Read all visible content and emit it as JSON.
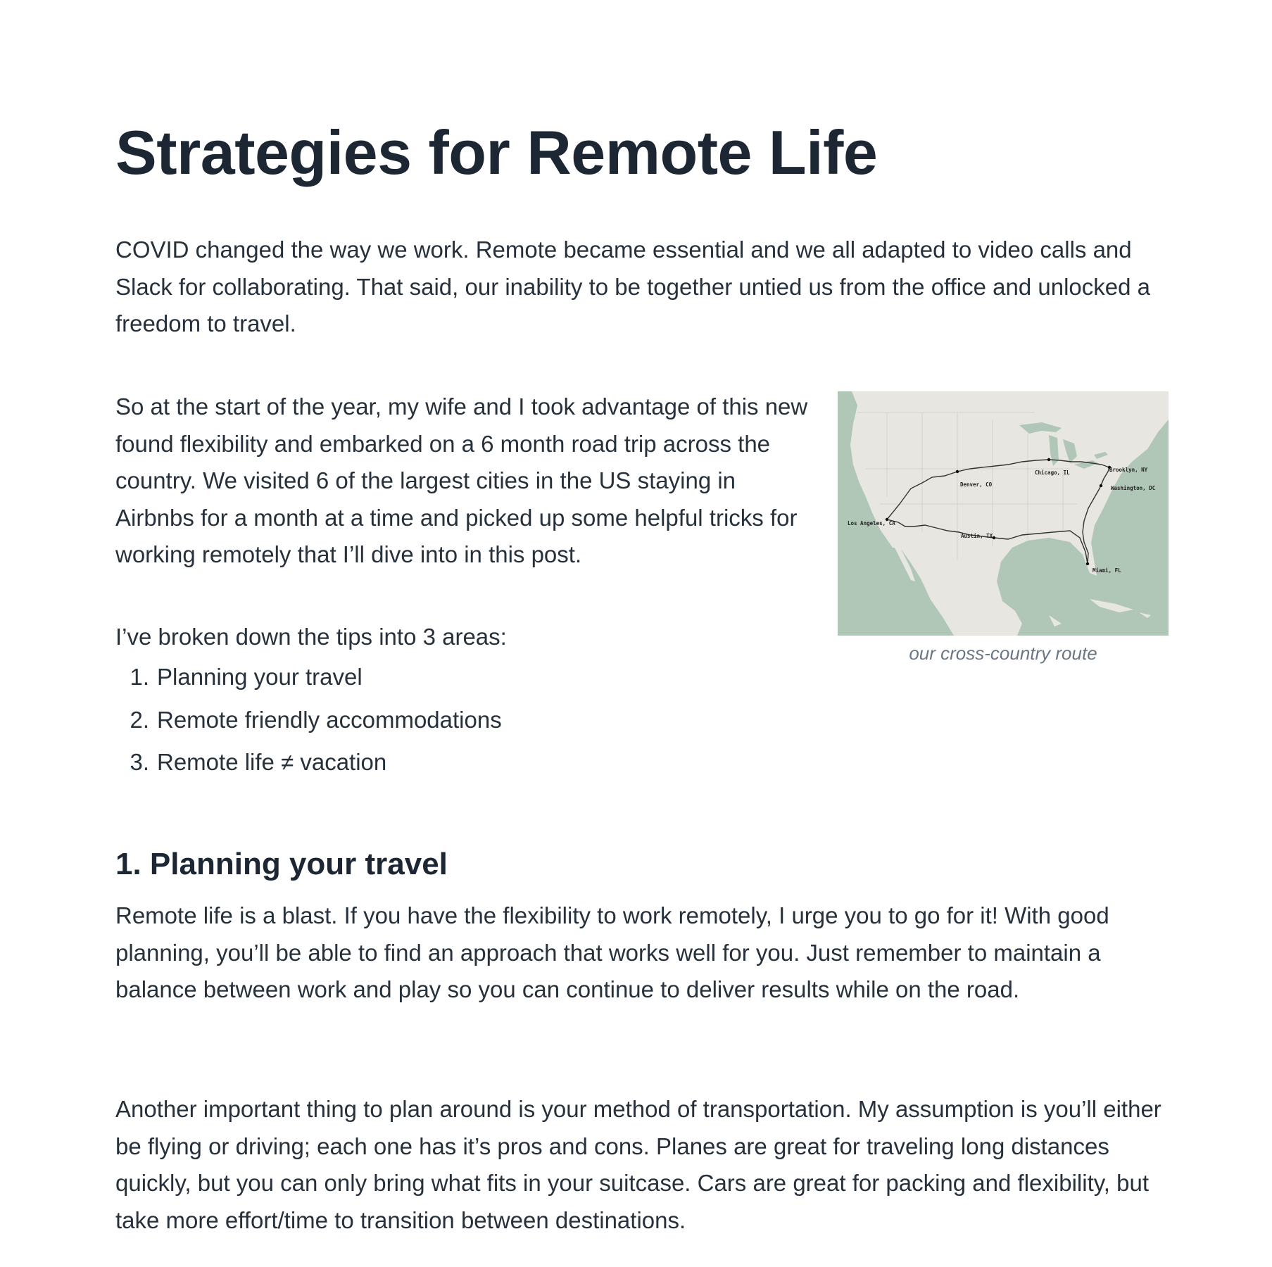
{
  "article": {
    "title": "Strategies for Remote Life",
    "intro": "COVID changed the way we work. Remote became essential and we all adapted to video calls and Slack for collaborating. That said, our inability to be together untied us from the office and unlocked a freedom to travel.",
    "trip": "So at the start of the year, my wife and I took advantage of this new found flexibility and embarked on a 6 month road trip across the country. We visited 6 of the largest cities in the US staying in Airbnbs for a month at a time and picked up some helpful tricks for working remotely that I’ll dive into in this post.",
    "areas_intro": "I’ve broken down the tips into 3 areas:",
    "areas": [
      {
        "num": "1.",
        "label": "Planning your travel"
      },
      {
        "num": "2.",
        "label": "Remote friendly accommodations"
      },
      {
        "num": "3.",
        "label": "Remote life ≠ vacation"
      }
    ],
    "section1_heading": "1. Planning your travel",
    "section1_p1": "Remote life is a blast. If you have the flexibility to work remotely, I urge you to go for it! With good planning, you’ll be able to find an approach that works well for you. Just remember to maintain a balance between work and play so you can continue to deliver results while on the road.",
    "section1_p2": "Another important thing to plan around is your method of transportation. My assumption is you’ll either be flying or driving; each one has it’s pros and cons. Planes are great for traveling long distances quickly, but you can only bring what fits in your suitcase. Cars are great for packing and flexibility, but take more effort/time to transition between destinations."
  },
  "map": {
    "caption": "our cross-country route",
    "cities": [
      {
        "label": "Los Angeles, CA"
      },
      {
        "label": "Denver, CO"
      },
      {
        "label": "Chicago, IL"
      },
      {
        "label": "Brooklyn, NY"
      },
      {
        "label": "Washington, DC"
      },
      {
        "label": "Miami, FL"
      },
      {
        "label": "Austin, TX"
      }
    ],
    "colors": {
      "water": "#b0c7b8",
      "land": "#e8e6e1",
      "route": "#333333"
    }
  }
}
